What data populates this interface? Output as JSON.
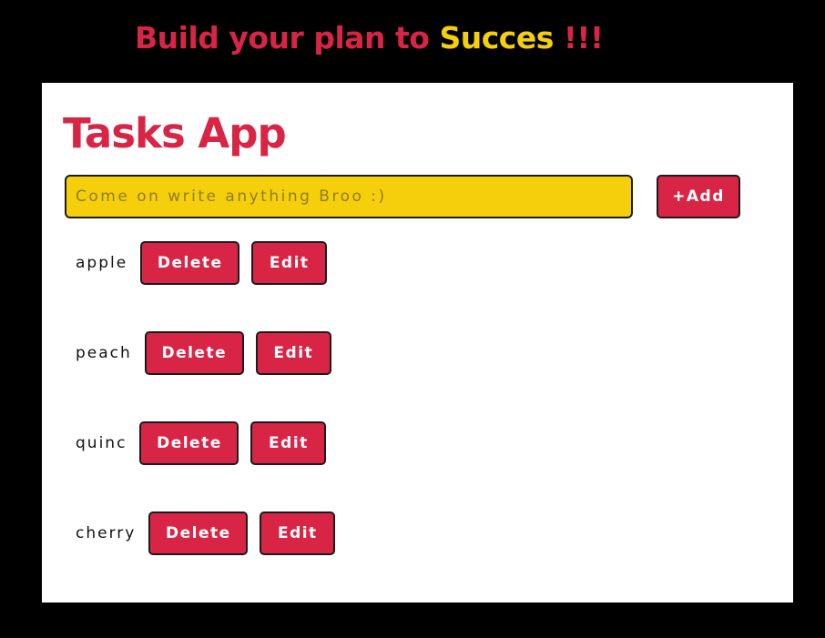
{
  "banner": {
    "text_part1": "Build your plan to ",
    "text_highlight": "Succes",
    "text_part2": " !!!"
  },
  "app": {
    "title": "Tasks App",
    "input_placeholder": "Come on write anything Broo :)",
    "input_value": "",
    "add_label": "+Add"
  },
  "tasks": [
    {
      "text": "apple",
      "delete_label": "Delete",
      "edit_label": "Edit"
    },
    {
      "text": "peach",
      "delete_label": "Delete",
      "edit_label": "Edit"
    },
    {
      "text": "quinc",
      "delete_label": "Delete",
      "edit_label": "Edit"
    },
    {
      "text": "cherry",
      "delete_label": "Delete",
      "edit_label": "Edit"
    }
  ],
  "colors": {
    "background": "#000000",
    "accent_red": "#d92545",
    "accent_yellow": "#f5cf0c",
    "card": "#ffffff"
  }
}
